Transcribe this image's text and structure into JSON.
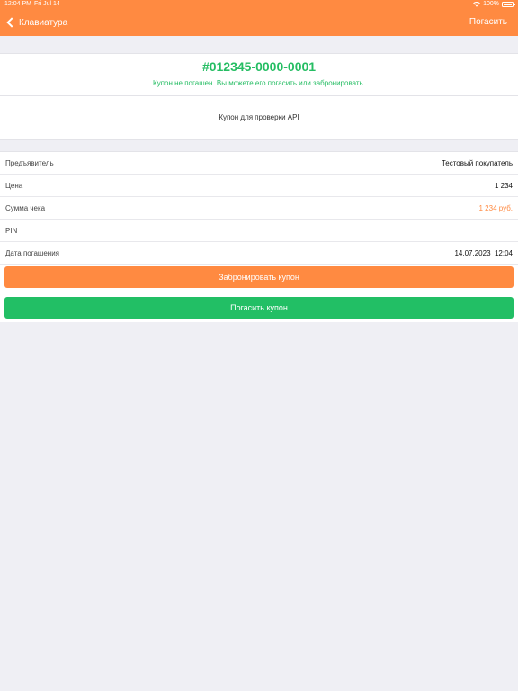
{
  "status_bar": {
    "time": "12:04 PM",
    "date": "Fri Jul 14",
    "battery": "100%"
  },
  "nav": {
    "back_label": "Клавиатура",
    "action_label": "Погасить"
  },
  "coupon": {
    "code": "#012345-0000-0001",
    "status": "Купон не погашен. Вы можете его погасить или забронировать.",
    "description": "Купон для проверки API"
  },
  "details": [
    {
      "label": "Предъявитель",
      "value": "Тестовый покупатель"
    },
    {
      "label": "Цена",
      "value": "1 234"
    },
    {
      "label": "Сумма чека",
      "value": "1 234 руб."
    },
    {
      "label": "PIN",
      "value": ""
    },
    {
      "label": "Дата погашения",
      "value": "14.07.2023  12:04"
    }
  ],
  "buttons": {
    "reserve": "Забронировать купон",
    "redeem": "Погасить купон"
  },
  "colors": {
    "accent": "#ff8a41",
    "success": "#22bf65",
    "background": "#efeff4"
  }
}
